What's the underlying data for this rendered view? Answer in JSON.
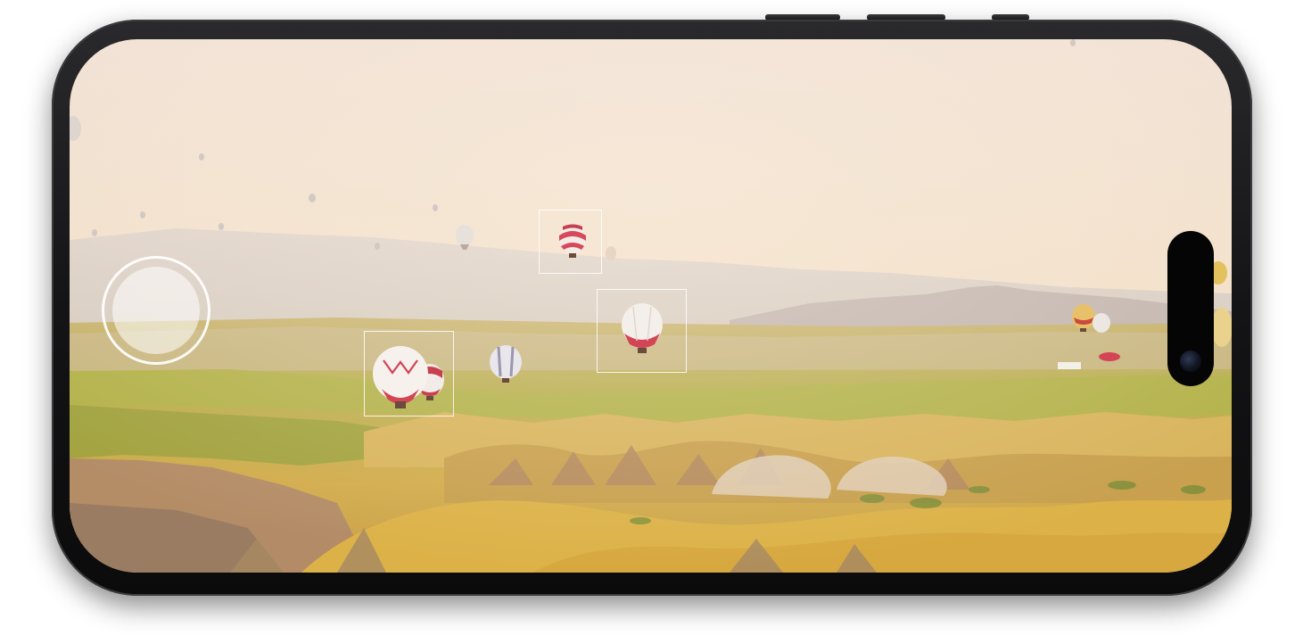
{
  "app": {
    "screen": "camera-viewfinder",
    "scene": "hot-air-balloons-over-valley"
  },
  "colors": {
    "sky_top": "#f2e3d6",
    "sky_horizon": "#f0dcbe",
    "mountains": "#c8c0bc",
    "terrain_yellow": "#d9b34a",
    "terrain_green": "#a9b34a",
    "terrain_shadow": "#9c7a55",
    "balloon_red": "#d7495a",
    "balloon_white": "#f3efea",
    "overlay_white": "#ffffff",
    "phone_frame": "#141416"
  },
  "controls": {
    "shutter_icon": "shutter-circle-icon",
    "focus_boxes": 3
  },
  "hardware": {
    "camera_icon": "front-camera-lens-icon"
  }
}
